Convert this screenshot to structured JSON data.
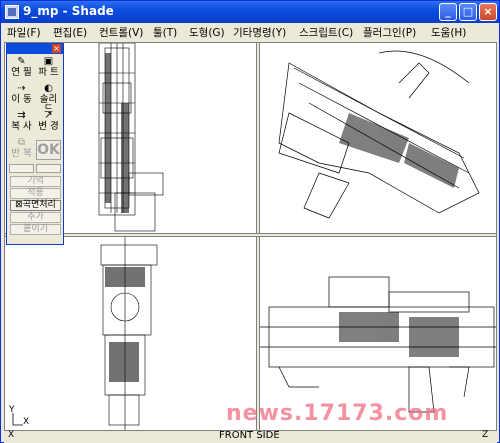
{
  "window": {
    "title": "9_mp - Shade"
  },
  "title_buttons": {
    "minimize": "_",
    "maximize": "□",
    "close": "×"
  },
  "menu": [
    "파일(F)",
    "편집(E)",
    "컨트롤(V)",
    "툴(T)",
    "도형(G)",
    "기타명령(Y)",
    "스크립트(C)",
    "플러그인(P)",
    "도움(H)"
  ],
  "palette": {
    "close": "×",
    "tools": [
      {
        "label": "연 필",
        "icon": "pencil-icon",
        "glyph": "✎"
      },
      {
        "label": "파 트",
        "icon": "parts-icon",
        "glyph": "▣"
      },
      {
        "label": "이 동",
        "icon": "move-icon",
        "glyph": "⇢"
      },
      {
        "label": "솔리드",
        "icon": "solid-icon",
        "glyph": "◐"
      },
      {
        "label": "복 사",
        "icon": "copy-icon",
        "glyph": "⇉"
      },
      {
        "label": "변 경",
        "icon": "transform-icon",
        "glyph": "↗"
      },
      {
        "label": "반 복",
        "icon": "repeat-icon",
        "glyph": "⧉"
      }
    ],
    "ok_label": "OK",
    "wide_buttons": [
      {
        "label": "기억",
        "enabled": false
      },
      {
        "label": "적용",
        "enabled": false
      },
      {
        "label": "⊠곡면처리",
        "enabled": true
      },
      {
        "label": "추가",
        "enabled": false
      },
      {
        "label": "붙이기",
        "enabled": false
      }
    ]
  },
  "status": {
    "view_label": "FRONT SIDE",
    "axis_x": "X",
    "axis_y": "Y",
    "axis_z": "Z"
  },
  "watermark": "news.17173.com"
}
